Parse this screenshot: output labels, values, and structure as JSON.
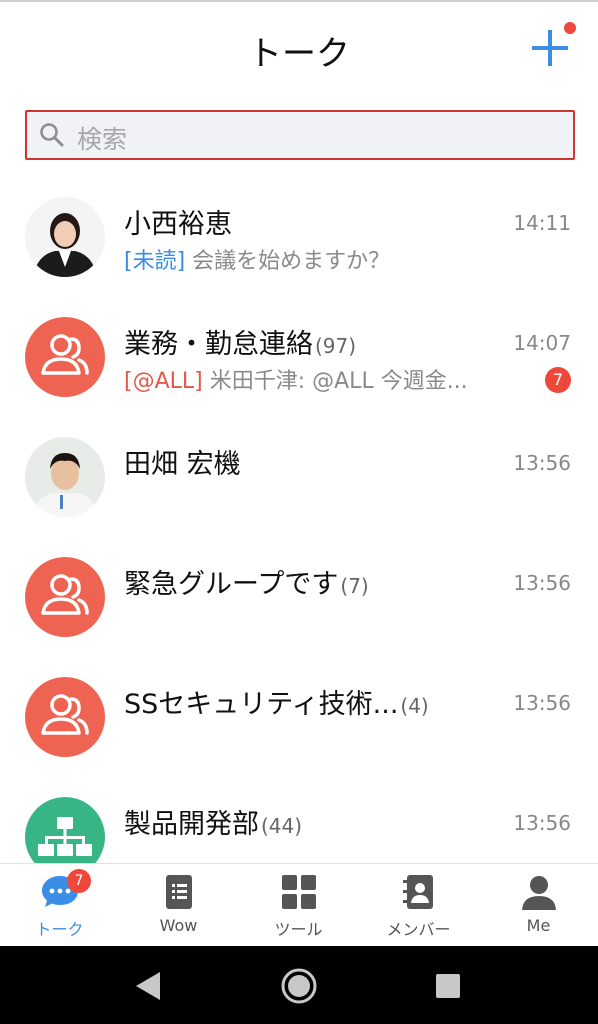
{
  "header": {
    "title": "トーク"
  },
  "search": {
    "placeholder": "検索"
  },
  "chats": [
    {
      "name": "小西裕恵",
      "count": "",
      "time": "14:11",
      "tag": "[未読]",
      "preview": " 会議を始めますか？",
      "badge": ""
    },
    {
      "name": "業務・勤怠連絡",
      "count": "(97)",
      "time": "14:07",
      "tag": "[@ALL]",
      "preview": " 米田千津: @ALL 今週金...",
      "badge": "7"
    },
    {
      "name": "田畑 宏機",
      "count": "",
      "time": "13:56",
      "tag": "",
      "preview": "",
      "badge": ""
    },
    {
      "name": "緊急グループです",
      "count": "(7)",
      "time": "13:56",
      "tag": "",
      "preview": "",
      "badge": ""
    },
    {
      "name": "SSセキュリティ技術...",
      "count": "(4)",
      "time": "13:56",
      "tag": "",
      "preview": "",
      "badge": ""
    },
    {
      "name": "製品開発部",
      "count": "(44)",
      "time": "13:56",
      "tag": "",
      "preview": "",
      "badge": ""
    }
  ],
  "tabs": [
    {
      "label": "トーク",
      "icon": "chat-bubble-icon",
      "badge": "7",
      "active": true
    },
    {
      "label": "Wow",
      "icon": "document-icon",
      "active": false
    },
    {
      "label": "ツール",
      "icon": "grid-icon",
      "active": false
    },
    {
      "label": "メンバー",
      "icon": "contacts-icon",
      "active": false
    },
    {
      "label": "Me",
      "icon": "person-icon",
      "active": false
    }
  ],
  "colors": {
    "accent": "#3a8ee6",
    "badge": "#f0473b",
    "group_avatar": "#ee6352",
    "org_avatar": "#38b585",
    "search_border": "#d23434"
  }
}
